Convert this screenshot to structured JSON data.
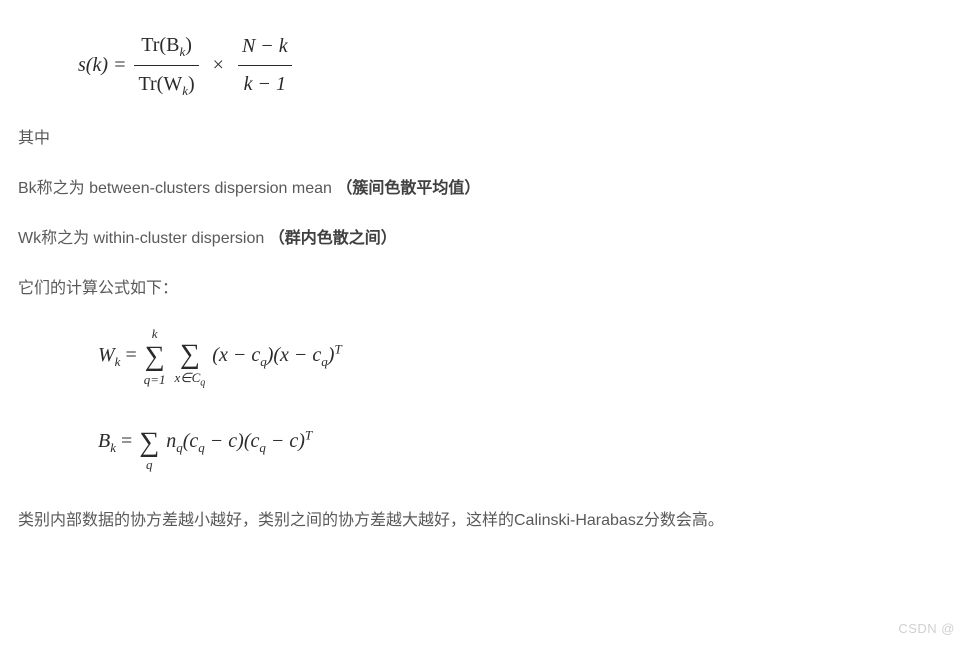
{
  "formula1": {
    "sk": "s(k) =",
    "tr_bk": "Tr(B",
    "tr_wk": "Tr(W",
    "k_sub": "k",
    "close": ")",
    "times": "×",
    "nmk": "N − k",
    "km1": "k − 1"
  },
  "text": {
    "where": "其中",
    "bk_line_prefix": "Bk称之为 between-clusters dispersion mean   ",
    "bk_bold": "（簇间色散平均值）",
    "wk_line_prefix": "Wk称之为 within-cluster dispersion  ",
    "wk_bold": "（群内色散之间）",
    "formula_intro": "它们的计算公式如下：",
    "conclusion": "类别内部数据的协方差越小越好，类别之间的协方差越大越好，这样的Calinski-Harabasz分数会高。"
  },
  "formula2": {
    "wk_label": "W",
    "k_sub": "k",
    "equals": " = ",
    "sum_top_k": "k",
    "sum_bot_q1": "q=1",
    "sum_bot_xcq": "x∈C",
    "q_sub": "q",
    "term_open": "(x − c",
    "term_close_1": ")(x − c",
    "term_close_2": ")",
    "sup_T": "T"
  },
  "formula3": {
    "bk_label": "B",
    "k_sub": "k",
    "equals": " = ",
    "sum_bot_q": "q",
    "n_label": "n",
    "q_sub": "q",
    "term_open": "(c",
    "minus_c": " − c)(c",
    "minus_c2": " − c)",
    "sup_T": "T"
  },
  "watermark": "CSDN @"
}
